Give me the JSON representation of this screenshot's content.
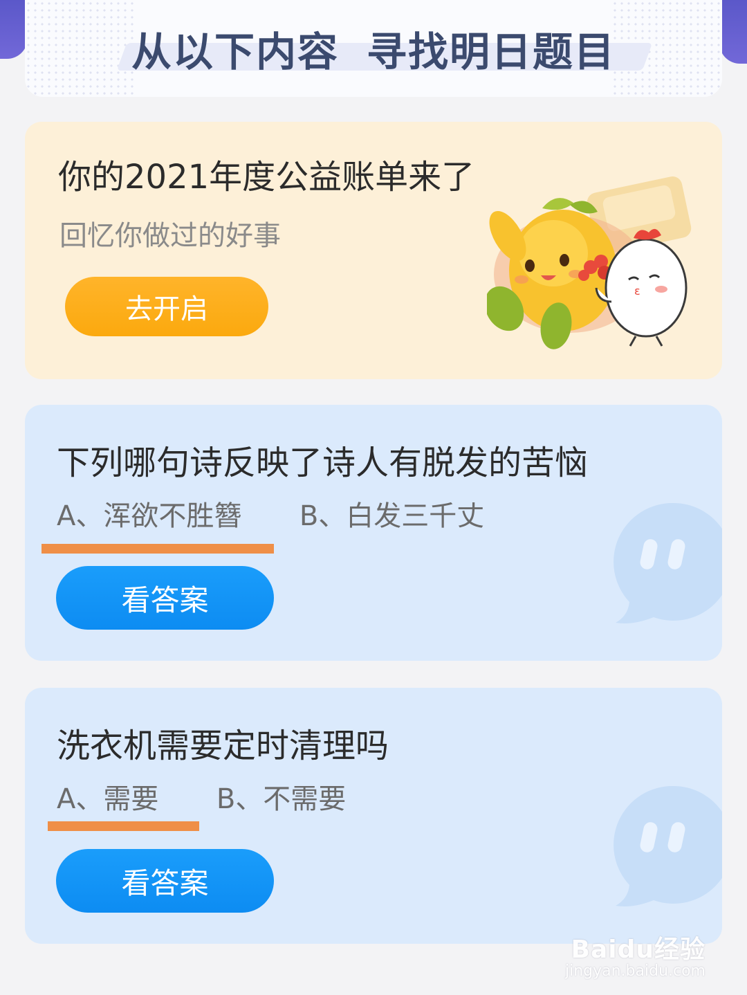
{
  "header": {
    "title_part1": "从以下内容",
    "title_part2": "寻找明日题目"
  },
  "promo": {
    "title": "你的2021年度公益账单来了",
    "subtitle": "回忆你做过的好事",
    "button_label": "去开启"
  },
  "quizzes": [
    {
      "question": "下列哪句诗反映了诗人有脱发的苦恼",
      "option_a": "A、浑欲不胜簪",
      "option_b": "B、白发三千丈",
      "selected_option": "A",
      "button_label": "看答案"
    },
    {
      "question": "洗衣机需要定时清理吗",
      "option_a": "A、需要",
      "option_b": "B、不需要",
      "selected_option": "A",
      "button_label": "看答案"
    }
  ],
  "watermark": {
    "brand": "Baidu经验",
    "url": "jingyan.baidu.com"
  },
  "colors": {
    "promo_bg": "#fdf0d8",
    "quiz_bg": "#dbeafc",
    "orange_button": "#fba90e",
    "blue_button": "#0d8cf2",
    "underline": "#ef8f47",
    "header_accent": "#5b58c9"
  }
}
